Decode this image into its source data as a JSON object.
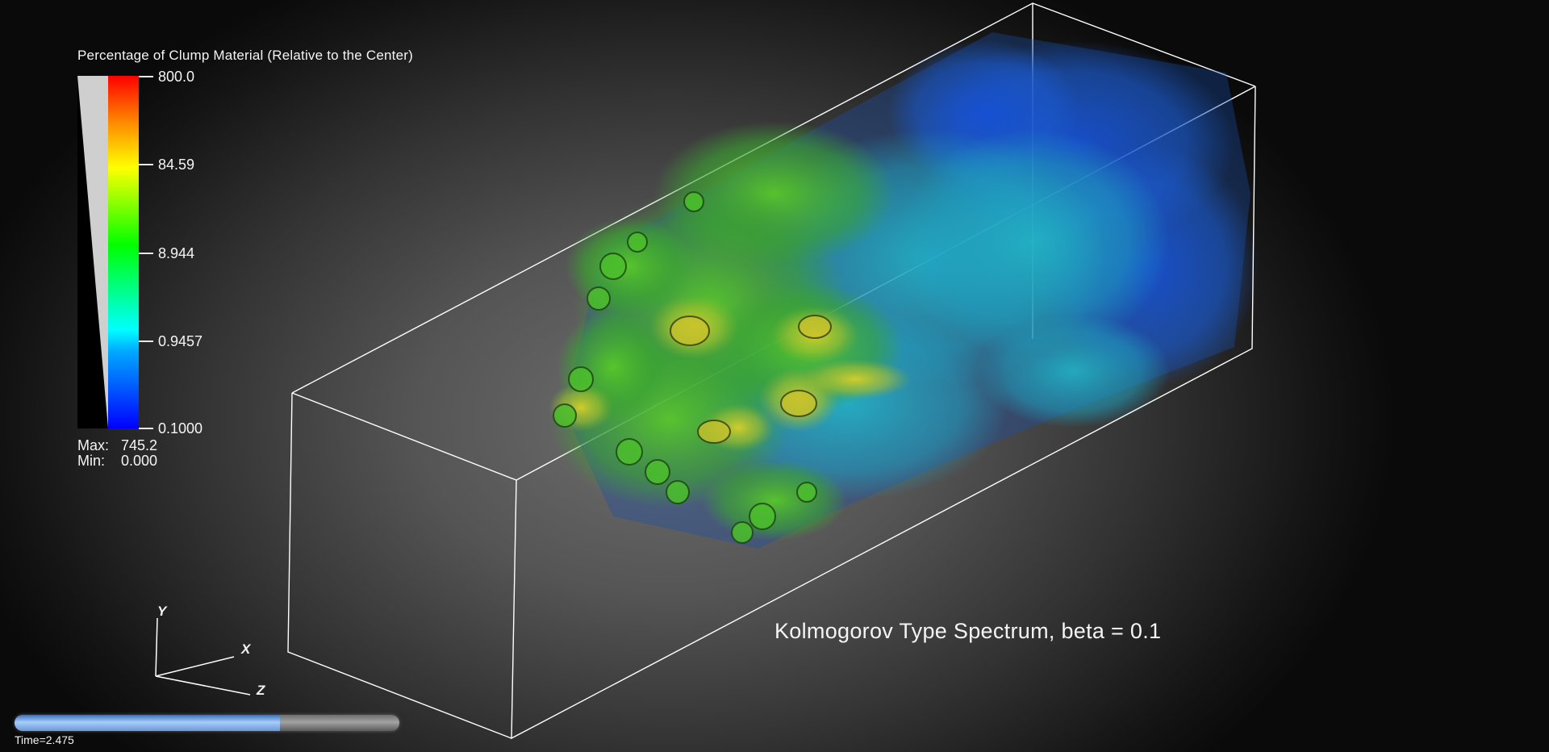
{
  "legend": {
    "title": "Percentage of Clump Material (Relative to the Center)",
    "ticks": [
      "800.0",
      "84.59",
      "8.944",
      "0.9457",
      "0.1000"
    ],
    "max_label": "Max:",
    "max_value": "745.2",
    "min_label": "Min:",
    "min_value": "0.000"
  },
  "axes": {
    "x_label": "X",
    "y_label": "Y",
    "z_label": "Z"
  },
  "caption": "Kolmogorov Type Spectrum, beta = 0.1",
  "time": {
    "readout": "Time=2.475",
    "progress": 0.69
  },
  "colors": {
    "background_center": "#6e6e6e",
    "background_edge": "#0a0a0a",
    "colormap": [
      "#0000ff",
      "#00ffff",
      "#00ff00",
      "#ffff00",
      "#ff0000"
    ],
    "slider_fill": "#a6cdfb"
  }
}
